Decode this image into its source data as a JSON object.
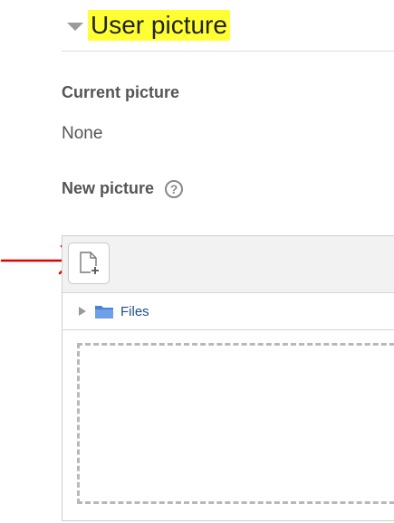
{
  "section": {
    "title": "User picture"
  },
  "current_picture": {
    "label": "Current picture",
    "value": "None"
  },
  "new_picture": {
    "label": "New picture",
    "help_icon": "question-circle-icon"
  },
  "file_manager": {
    "add_icon": "add-file-icon",
    "folder_icon": "folder-icon",
    "path_label": "Files"
  },
  "colors": {
    "title_highlight": "#ffff33",
    "annotation_arrow": "#e00000",
    "link": "#1a4f8b",
    "folder": "#4a82d6"
  }
}
